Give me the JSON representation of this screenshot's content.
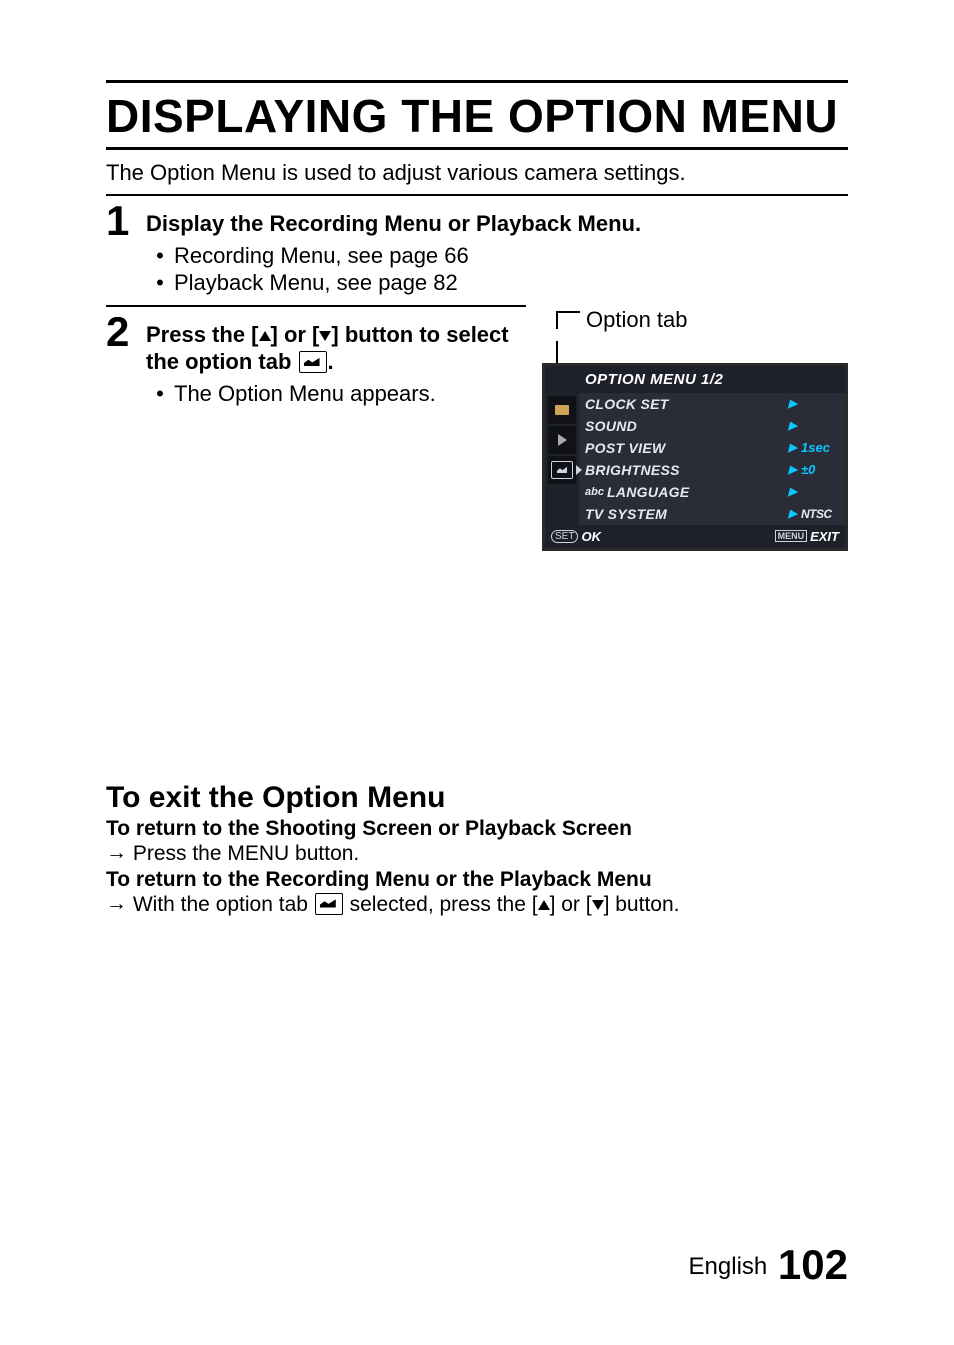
{
  "title": "DISPLAYING THE OPTION MENU",
  "intro": "The Option Menu is used to adjust various camera settings.",
  "step1": {
    "num": "1",
    "heading": "Display the Recording Menu or Playback Menu.",
    "bullet1": "Recording Menu, see page 66",
    "bullet2": "Playback Menu, see page 82"
  },
  "step2": {
    "num": "2",
    "heading_part1": "Press the [",
    "heading_part2": "] or [",
    "heading_part3": "] button to select the option tab ",
    "heading_part4": ".",
    "bullet1": "The Option Menu appears."
  },
  "figure": {
    "label": "Option tab",
    "title": "OPTION MENU 1/2",
    "items": [
      {
        "label": "CLOCK SET",
        "value": ""
      },
      {
        "label": "SOUND",
        "value": ""
      },
      {
        "label": "POST VIEW",
        "value": "1sec"
      },
      {
        "label": "BRIGHTNESS",
        "value": "±0"
      },
      {
        "label": "LANGUAGE",
        "prefix": "abc",
        "value": ""
      },
      {
        "label": "TV SYSTEM",
        "value": "NTSC",
        "ntsc": true
      }
    ],
    "footer": {
      "ok_badge": "SET",
      "ok": "OK",
      "exit_badge": "MENU",
      "exit": "EXIT"
    }
  },
  "exit": {
    "heading": "To exit the Option Menu",
    "sub1_bold": "To return to the Shooting Screen or Playback Screen",
    "sub1_line": " Press the MENU button.",
    "sub2_bold": "To return to the Recording Menu or the Playback Menu",
    "sub2_line_a": " With the option tab ",
    "sub2_line_b": " selected, press the [",
    "sub2_line_c": "] or [",
    "sub2_line_d": "] button."
  },
  "footer": {
    "lang": "English",
    "page": "102"
  }
}
